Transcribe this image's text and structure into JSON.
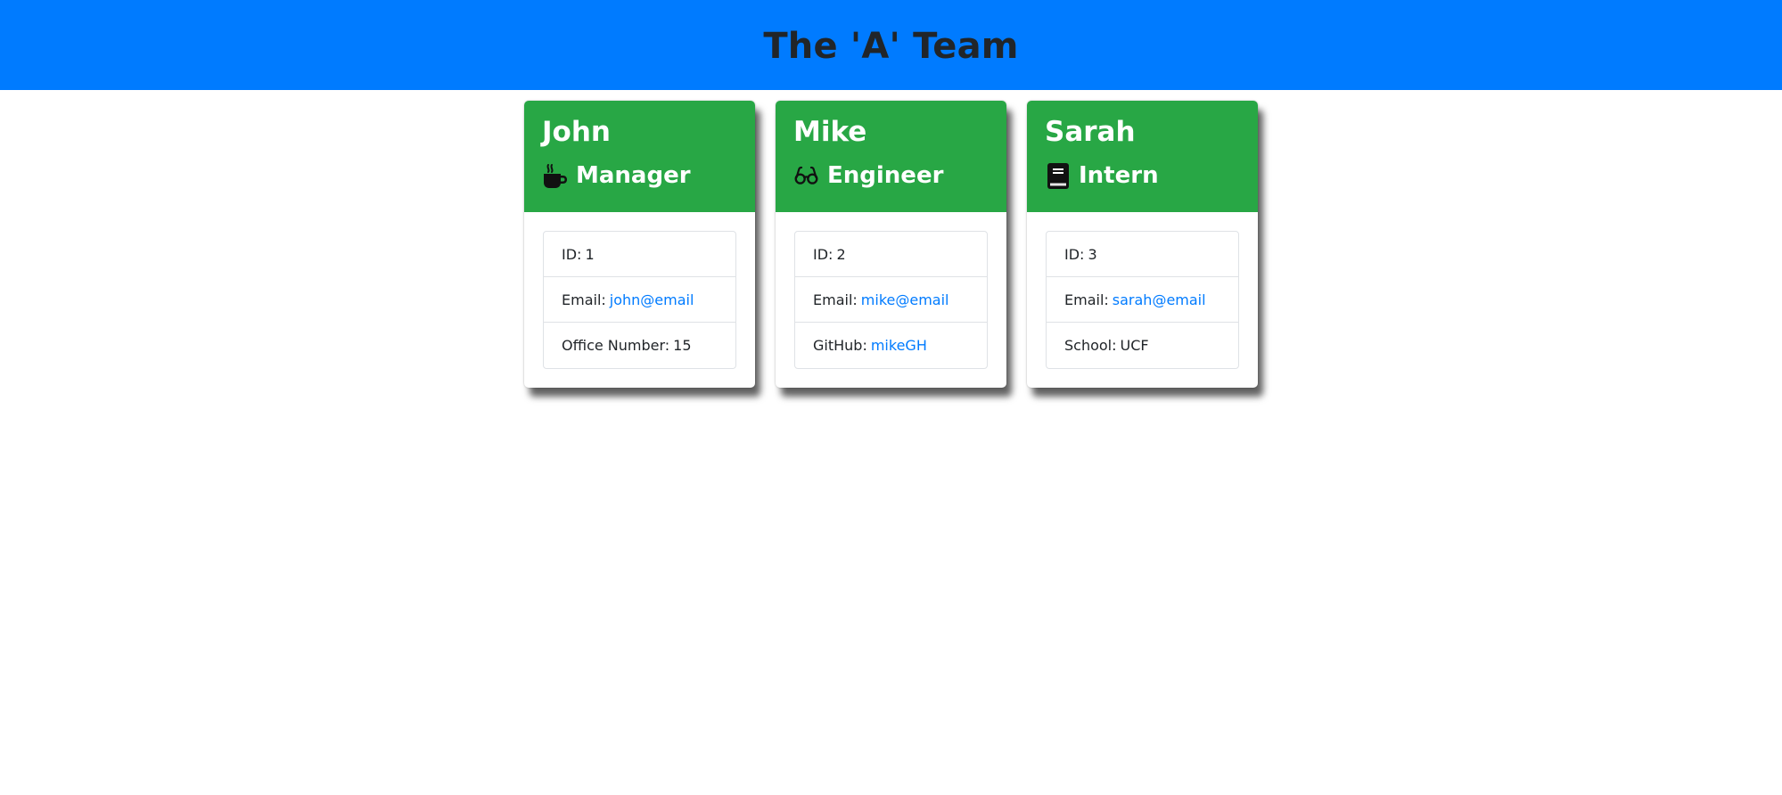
{
  "header": {
    "title": "The 'A' Team"
  },
  "colors": {
    "banner": "#007bff",
    "card_header": "#28a745",
    "link": "#007bff"
  },
  "team": [
    {
      "name": "John",
      "role": "Manager",
      "icon": "mug-icon",
      "id_label": "ID:",
      "id_value": "1",
      "email_label": "Email:",
      "email": "john@email",
      "extra_label": "Office Number:",
      "extra_value": "15"
    },
    {
      "name": "Mike",
      "role": "Engineer",
      "icon": "glasses-icon",
      "id_label": "ID:",
      "id_value": "2",
      "email_label": "Email:",
      "email": "mike@email",
      "extra_label": "GitHub:",
      "extra_value": "mikeGH"
    },
    {
      "name": "Sarah",
      "role": "Intern",
      "icon": "book-icon",
      "id_label": "ID:",
      "id_value": "3",
      "email_label": "Email:",
      "email": "sarah@email",
      "extra_label": "School:",
      "extra_value": "UCF"
    }
  ]
}
